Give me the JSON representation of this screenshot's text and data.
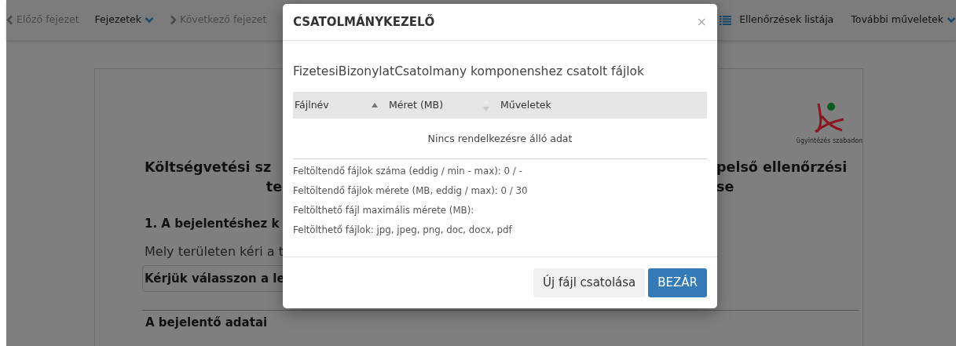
{
  "toolbar": {
    "left": [
      {
        "label": "Előző fejezet",
        "kind": "back",
        "disabled": true
      },
      {
        "label": "Fejezetek",
        "kind": "menu",
        "disabled": false
      },
      {
        "label": "Következő fejezet",
        "kind": "forward",
        "disabled": true
      }
    ],
    "right": [
      {
        "label": "Ellenőrzések listája",
        "kind": "list",
        "disabled": false
      },
      {
        "label": "További műveletek",
        "kind": "menu",
        "disabled": false
      }
    ]
  },
  "document": {
    "logo_caption": "ügyintézés szabadon",
    "title_left": [
      "Költségvetési sz",
      "te"
    ],
    "title_right": [
      "pelső ellenőrzési",
      "se"
    ],
    "section_heading": "1. A bejelentéshez k",
    "question": "Mely területen kéri a t",
    "select_value": "Kérjük válasszon a le",
    "subsection": "A bejelentő adatai"
  },
  "modal": {
    "title": "CSATOLMÁNYKEZELŐ",
    "close": "×",
    "subtitle": "FizetesiBizonylatCsatolmany komponenshez csatolt fájlok",
    "table": {
      "columns": [
        {
          "label": "Fájlnév",
          "kind": "ascending"
        },
        {
          "label": "Méret (MB)",
          "kind": "sortable"
        },
        {
          "label": "Műveletek",
          "kind": "plain"
        }
      ],
      "empty_text": "Nincs rendelkezésre álló adat"
    },
    "info": [
      "Feltöltendő fájlok száma (eddig / min - max): 0 / -",
      "Feltöltendő fájlok mérete (MB, eddig / max): 0 / 30",
      "Feltölthető fájl maximális mérete (MB):",
      "Feltölthető fájlok: jpg, jpeg, png, doc, docx, pdf"
    ],
    "buttons": [
      {
        "label": "Új fájl csatolása",
        "kind": "secondary"
      },
      {
        "label": "BEZÁR",
        "kind": "primary"
      }
    ]
  }
}
